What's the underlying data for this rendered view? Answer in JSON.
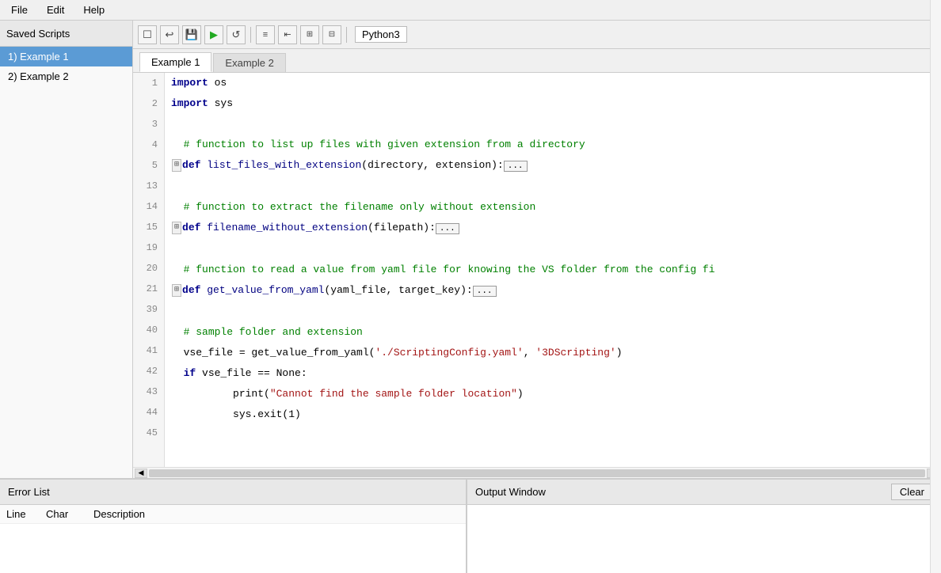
{
  "sidebar": {
    "title": "Saved Scripts",
    "items": [
      {
        "id": "example1",
        "label": "1) Example 1",
        "active": true
      },
      {
        "id": "example2",
        "label": "2) Example 2",
        "active": false
      }
    ]
  },
  "menu": {
    "items": [
      "File",
      "Edit",
      "Help"
    ]
  },
  "toolbar": {
    "buttons": [
      "☐",
      "↩",
      "💾",
      "▶",
      "↺"
    ],
    "lang": "Python3"
  },
  "tabs": [
    {
      "id": "tab1",
      "label": "Example 1",
      "active": true
    },
    {
      "id": "tab2",
      "label": "Example 2",
      "active": false
    }
  ],
  "code": {
    "lines": [
      {
        "num": "1",
        "content": "import os"
      },
      {
        "num": "2",
        "content": "import sys"
      },
      {
        "num": "3",
        "content": ""
      },
      {
        "num": "4",
        "content": "  # function to list up files with given extension from a directory"
      },
      {
        "num": "5",
        "content": "⊞def list_files_with_extension(directory, extension):..."
      },
      {
        "num": "13",
        "content": ""
      },
      {
        "num": "14",
        "content": "  # function to extract the filename only without extension"
      },
      {
        "num": "15",
        "content": "⊞def filename_without_extension(filepath):..."
      },
      {
        "num": "19",
        "content": ""
      },
      {
        "num": "20",
        "content": "  # function to read a value from yaml file for knowing the VS folder from the config fi"
      },
      {
        "num": "21",
        "content": "⊞def get_value_from_yaml(yaml_file, target_key):..."
      },
      {
        "num": "39",
        "content": ""
      },
      {
        "num": "40",
        "content": "  # sample folder and extension"
      },
      {
        "num": "41",
        "content": "  vse_file = get_value_from_yaml('./ScriptingConfig.yaml', '3DScripting')"
      },
      {
        "num": "42",
        "content": "  if vse_file == None:"
      },
      {
        "num": "43",
        "content": "          print(\"Cannot find the sample folder location\")"
      },
      {
        "num": "44",
        "content": "          sys.exit(1)"
      },
      {
        "num": "45",
        "content": ""
      }
    ]
  },
  "error_panel": {
    "title": "Error List",
    "columns": {
      "line": "Line",
      "char": "Char",
      "description": "Description"
    }
  },
  "output_panel": {
    "title": "Output Window",
    "clear_label": "Clear"
  }
}
